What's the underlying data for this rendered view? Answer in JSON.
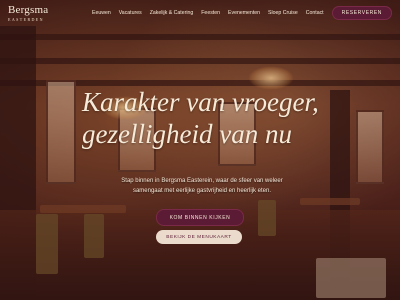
{
  "brand": {
    "name": "Bergsma",
    "subtitle": "EASTERDEN"
  },
  "nav": {
    "items": [
      "Eeuwen",
      "Vacatures",
      "Zakelijk & Catering",
      "Feesten",
      "Evenementen",
      "Sloep Cruise",
      "Contact"
    ]
  },
  "header": {
    "reserve_label": "RESERVEREN"
  },
  "hero": {
    "headline_line1": "Karakter van vroeger,",
    "headline_line2": "gezelligheid van nu",
    "intro": "Stap binnen in Bergsma Easterein, waar de sfeer van weleer samengaat met eerlijke gastvrijheid en heerlijk eten.",
    "cta_primary": "KOM BINNEN KIJKEN",
    "cta_secondary": "BEKIJK DE MENUKAART"
  },
  "colors": {
    "accent": "#5b1b34",
    "text": "#f6ead8",
    "secondary_button_bg": "#faebdc"
  }
}
